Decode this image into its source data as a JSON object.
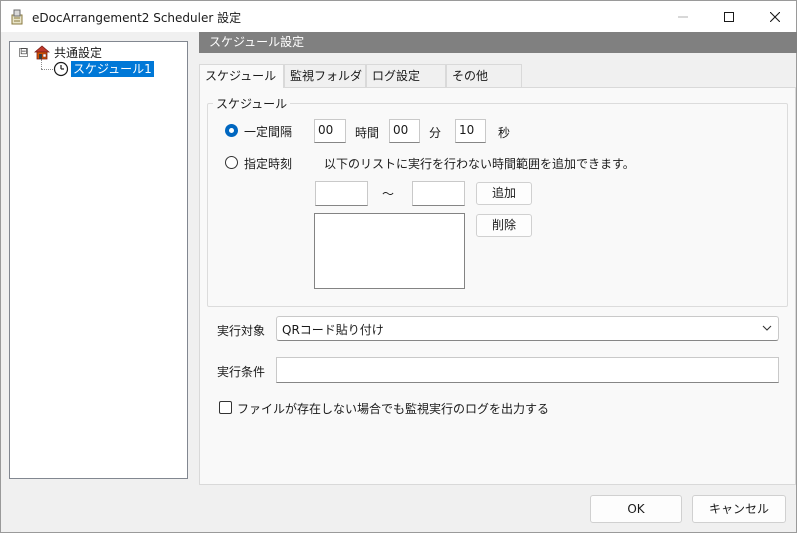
{
  "window": {
    "title": "eDocArrangement2 Scheduler 設定"
  },
  "tree": {
    "root_label": "共通設定",
    "expander": "⊟",
    "child_label": "スケジュール1"
  },
  "section_header": "スケジュール設定",
  "tabs": [
    "スケジュール",
    "監視フォルダ",
    "ログ設定",
    "その他"
  ],
  "schedule": {
    "group_label": "スケジュール",
    "interval_radio_label": "一定間隔",
    "interval_selected": true,
    "hours_value": "00",
    "hours_unit": "時間",
    "minutes_value": "00",
    "minutes_unit": "分",
    "seconds_value": "10",
    "seconds_unit": "秒",
    "fixed_radio_label": "指定時刻",
    "fixed_note": "以下のリストに実行を行わない時間範囲を追加できます。",
    "range_from": "",
    "range_separator": "～",
    "range_to": "",
    "add_button": "追加",
    "delete_button": "削除"
  },
  "execution_target": {
    "label": "実行対象",
    "value": "QRコード貼り付け"
  },
  "execution_condition": {
    "label": "実行条件",
    "value": ""
  },
  "log_checkbox": {
    "label": "ファイルが存在しない場合でも監視実行のログを出力する",
    "checked": false
  },
  "footer": {
    "ok_label": "OK",
    "cancel_label": "キャンセル"
  },
  "colors": {
    "accent": "#0078d7",
    "header_bg": "#808080",
    "radio_checked": "#0067c0"
  }
}
